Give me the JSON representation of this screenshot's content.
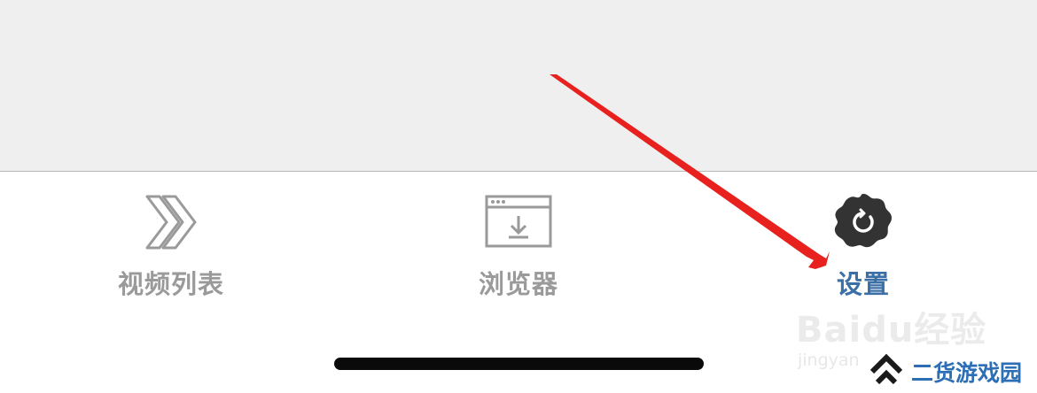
{
  "tabbar": {
    "tabs": [
      {
        "label": "视频列表",
        "icon": "double-chevron-right-icon",
        "color": "#9a9a9a",
        "active": false
      },
      {
        "label": "浏览器",
        "icon": "browser-download-icon",
        "color": "#9a9a9a",
        "active": false
      },
      {
        "label": "设置",
        "icon": "gear-icon",
        "color": "#3b6fa6",
        "active": true
      }
    ]
  },
  "colors": {
    "top_area_bg": "#f0eff0",
    "inactive": "#9a9a9a",
    "active": "#3b6fa6",
    "gear": "#333333",
    "arrow": "#e8211f",
    "home_indicator": "#0a0a0a"
  },
  "watermarks": {
    "baidu_brand": "Baidu经验",
    "baidu_sub": "jingyan",
    "site_name": "二货游戏园"
  }
}
